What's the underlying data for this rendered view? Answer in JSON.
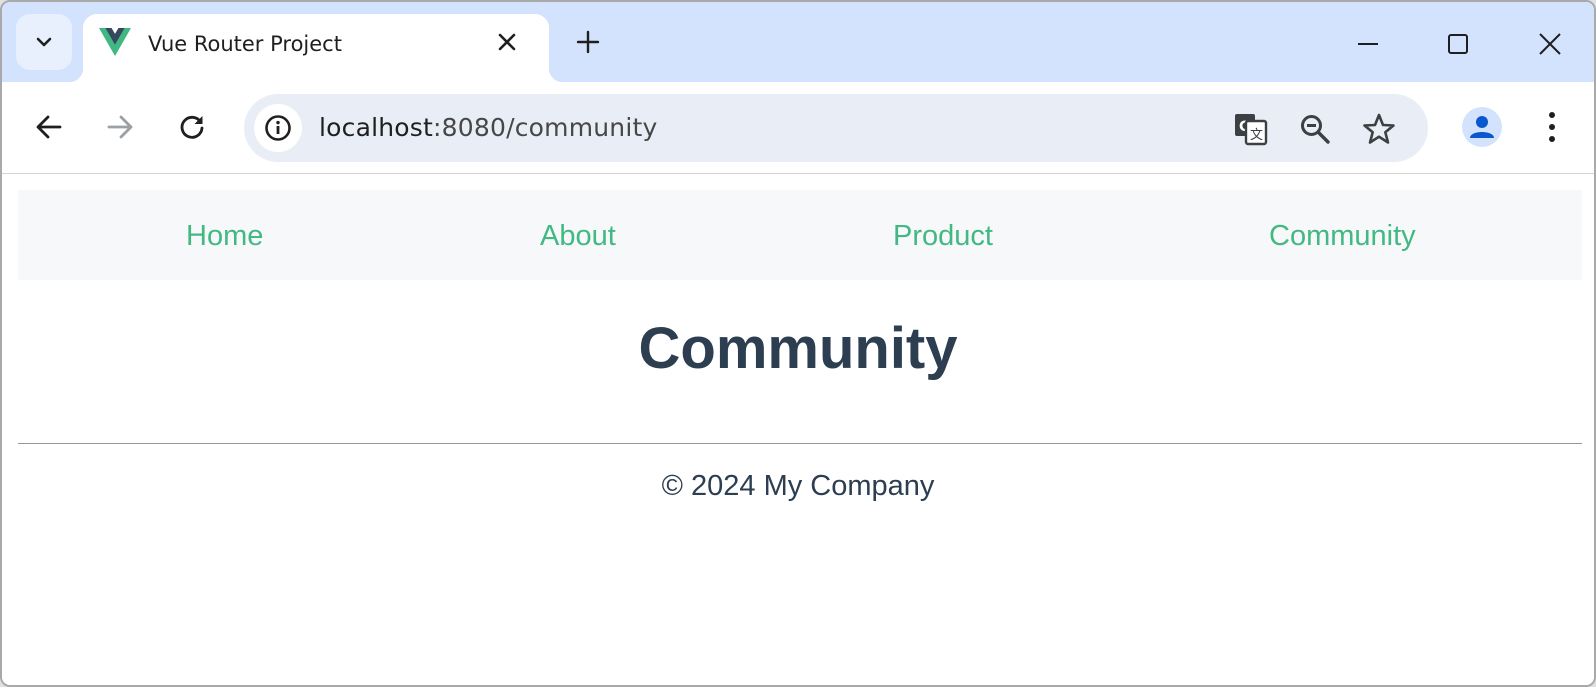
{
  "browser": {
    "tab": {
      "title": "Vue Router Project",
      "favicon": "vue-logo-icon"
    },
    "address_bar": {
      "host": "localhost",
      "path": ":8080/community"
    },
    "icons": {
      "tab_search": "chevron-down-icon",
      "tab_close": "close-icon",
      "new_tab": "plus-icon",
      "minimize": "minimize-icon",
      "maximize": "maximize-icon",
      "close_window": "close-icon",
      "back": "arrow-left-icon",
      "forward": "arrow-right-icon",
      "reload": "reload-icon",
      "site_info": "info-icon",
      "translate": "translate-icon",
      "zoom": "zoom-out-icon",
      "bookmark": "star-icon",
      "profile": "person-icon",
      "menu": "kebab-menu-icon"
    },
    "colors": {
      "tabstrip": "#d3e3fd",
      "omnibox": "#e9eef6"
    }
  },
  "page": {
    "nav": [
      {
        "label": "Home"
      },
      {
        "label": "About"
      },
      {
        "label": "Product"
      },
      {
        "label": "Community"
      }
    ],
    "heading": "Community",
    "footer": "© 2024 My Company",
    "colors": {
      "link": "#42b983",
      "text": "#2c3e50",
      "nav_background": "#f7f8fa"
    }
  }
}
